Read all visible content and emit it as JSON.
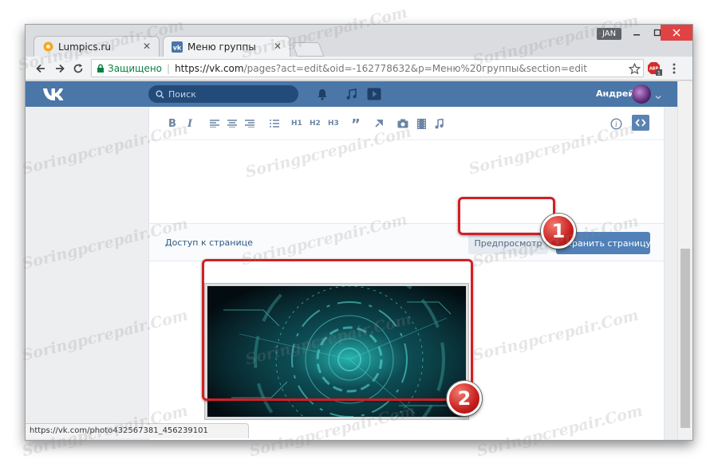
{
  "browser": {
    "tabs": [
      {
        "title": "Lumpics.ru",
        "favicon": "orange-circle-icon"
      },
      {
        "title": "Меню группы",
        "favicon": "vk-icon"
      }
    ],
    "user_badge": "JAN",
    "address_bar": {
      "secure_label": "Защищено",
      "separator": "|",
      "url_host": "https://vk.com",
      "url_rest": "/pages?act=edit&oid=-162778632&p=Меню%20группы&section=edit"
    },
    "extension_count": "1",
    "extension_abbr": "ABP",
    "status_url": "https://vk.com/photo432567381_456239101"
  },
  "vk": {
    "search_placeholder": "Поиск",
    "user_name": "Андрей",
    "header_color": "#4a76a8"
  },
  "editor": {
    "toolbar": [
      "B",
      "I",
      "H1",
      "H2",
      "H3",
      "”"
    ],
    "access_link": "Доступ к странице",
    "preview_button": "Предпросмотр",
    "save_button": "Сохранить страницу"
  },
  "annotations": {
    "marker_1": "1",
    "marker_2": "2",
    "marker_color": "#d21f26"
  },
  "watermark": "Soringpcrepair.Com"
}
